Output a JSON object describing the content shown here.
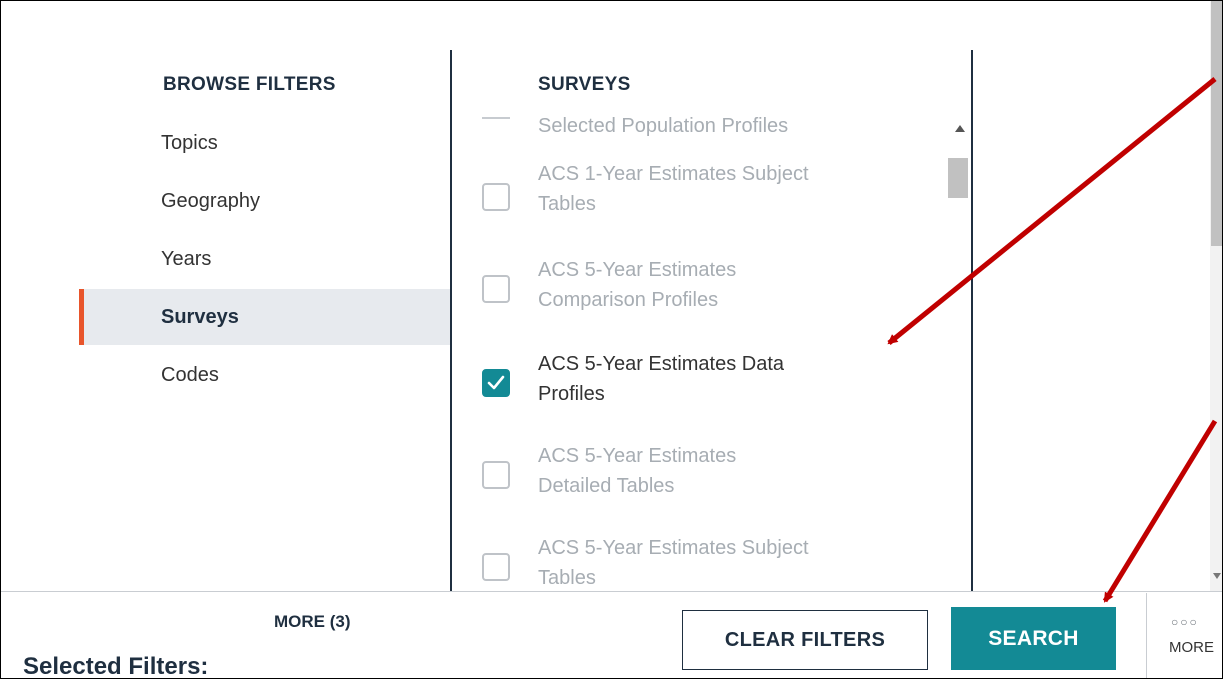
{
  "browse_filters": {
    "title": "BROWSE FILTERS",
    "items": [
      {
        "label": "Topics",
        "active": false
      },
      {
        "label": "Geography",
        "active": false
      },
      {
        "label": "Years",
        "active": false
      },
      {
        "label": "Surveys",
        "active": true
      },
      {
        "label": "Codes",
        "active": false
      }
    ]
  },
  "surveys": {
    "title": "SURVEYS",
    "items": [
      {
        "line1": "Selected Population Profiles",
        "line2": "",
        "checked": false
      },
      {
        "line1": "ACS 1-Year Estimates Subject",
        "line2": "Tables",
        "checked": false
      },
      {
        "line1": "ACS 5-Year Estimates",
        "line2": "Comparison Profiles",
        "checked": false
      },
      {
        "line1": "ACS 5-Year Estimates Data",
        "line2": "Profiles",
        "checked": true
      },
      {
        "line1": "ACS 5-Year Estimates",
        "line2": "Detailed Tables",
        "checked": false
      },
      {
        "line1": "ACS 5-Year Estimates Subject",
        "line2": "Tables",
        "checked": false
      }
    ]
  },
  "footer": {
    "selected_label": "Selected Filters:",
    "more_count": "MORE (3)",
    "clear_label": "CLEAR FILTERS",
    "search_label": "SEARCH",
    "more_dots": "○○○",
    "more_label": "MORE"
  },
  "colors": {
    "accent_teal": "#138a95",
    "active_marker": "#e8552b",
    "arrow": "#c00000",
    "heading": "#1f2f40"
  },
  "icons": {
    "checkmark": "check-icon",
    "scroll_up": "arrow-up-icon",
    "scroll_down": "arrow-down-icon",
    "more": "more-dots-icon"
  }
}
